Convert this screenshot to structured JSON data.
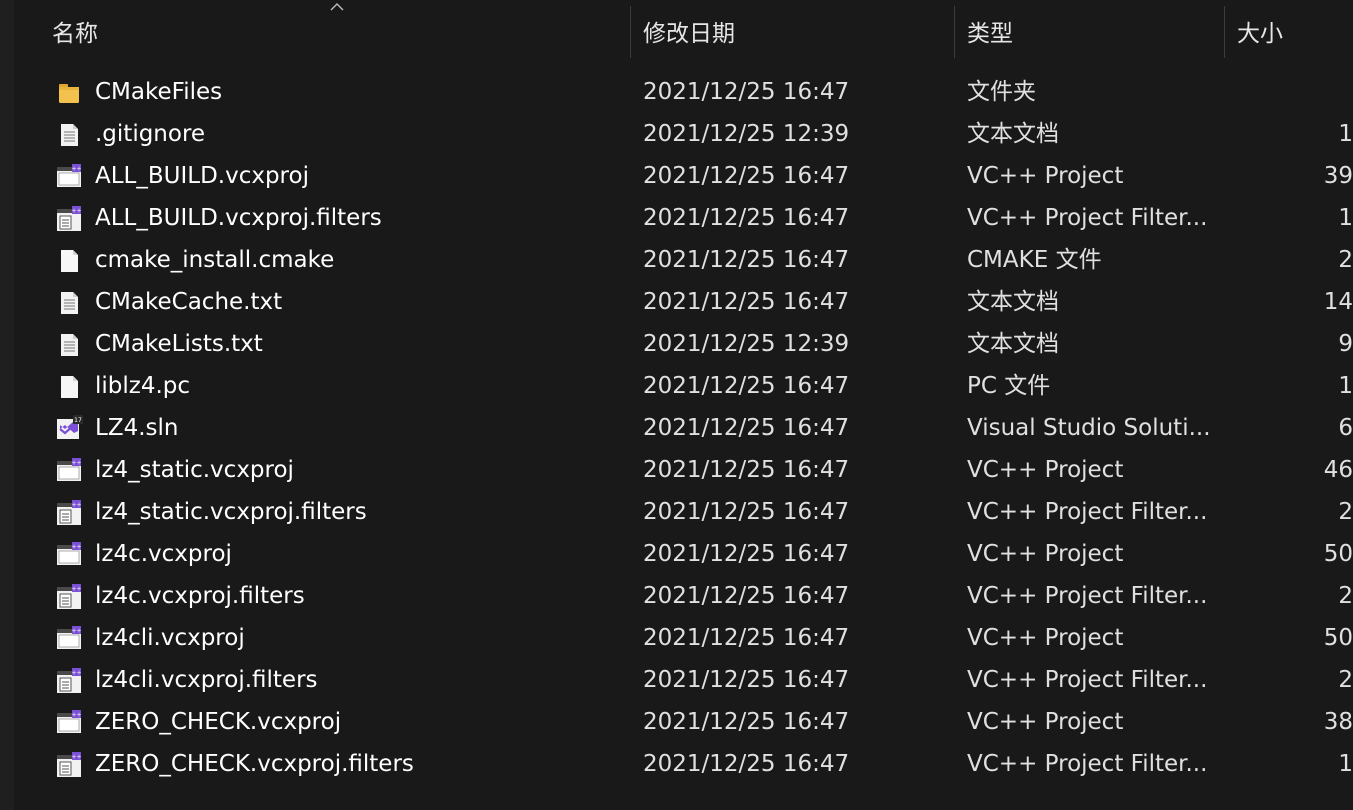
{
  "header": {
    "name": "名称",
    "date": "修改日期",
    "type": "类型",
    "size": "大小"
  },
  "files": [
    {
      "icon": "folder-icon",
      "name": "CMakeFiles",
      "date": "2021/12/25 16:47",
      "type": "文件夹",
      "size": ""
    },
    {
      "icon": "text-file-icon",
      "name": ".gitignore",
      "date": "2021/12/25 12:39",
      "type": "文本文档",
      "size": "1"
    },
    {
      "icon": "vcxproj-icon",
      "name": "ALL_BUILD.vcxproj",
      "date": "2021/12/25 16:47",
      "type": "VC++ Project",
      "size": "39"
    },
    {
      "icon": "filters-icon",
      "name": "ALL_BUILD.vcxproj.filters",
      "date": "2021/12/25 16:47",
      "type": "VC++ Project Filter...",
      "size": "1"
    },
    {
      "icon": "blank-file-icon",
      "name": "cmake_install.cmake",
      "date": "2021/12/25 16:47",
      "type": "CMAKE 文件",
      "size": "2"
    },
    {
      "icon": "text-file-icon",
      "name": "CMakeCache.txt",
      "date": "2021/12/25 16:47",
      "type": "文本文档",
      "size": "14"
    },
    {
      "icon": "text-file-icon",
      "name": "CMakeLists.txt",
      "date": "2021/12/25 12:39",
      "type": "文本文档",
      "size": "9"
    },
    {
      "icon": "blank-file-icon",
      "name": "liblz4.pc",
      "date": "2021/12/25 16:47",
      "type": "PC 文件",
      "size": "1"
    },
    {
      "icon": "visual-studio-solution-icon",
      "name": "LZ4.sln",
      "date": "2021/12/25 16:47",
      "type": "Visual Studio Soluti...",
      "size": "6"
    },
    {
      "icon": "vcxproj-icon",
      "name": "lz4_static.vcxproj",
      "date": "2021/12/25 16:47",
      "type": "VC++ Project",
      "size": "46"
    },
    {
      "icon": "filters-icon",
      "name": "lz4_static.vcxproj.filters",
      "date": "2021/12/25 16:47",
      "type": "VC++ Project Filter...",
      "size": "2"
    },
    {
      "icon": "vcxproj-icon",
      "name": "lz4c.vcxproj",
      "date": "2021/12/25 16:47",
      "type": "VC++ Project",
      "size": "50"
    },
    {
      "icon": "filters-icon",
      "name": "lz4c.vcxproj.filters",
      "date": "2021/12/25 16:47",
      "type": "VC++ Project Filter...",
      "size": "2"
    },
    {
      "icon": "vcxproj-icon",
      "name": "lz4cli.vcxproj",
      "date": "2021/12/25 16:47",
      "type": "VC++ Project",
      "size": "50"
    },
    {
      "icon": "filters-icon",
      "name": "lz4cli.vcxproj.filters",
      "date": "2021/12/25 16:47",
      "type": "VC++ Project Filter...",
      "size": "2"
    },
    {
      "icon": "vcxproj-icon",
      "name": "ZERO_CHECK.vcxproj",
      "date": "2021/12/25 16:47",
      "type": "VC++ Project",
      "size": "38"
    },
    {
      "icon": "filters-icon",
      "name": "ZERO_CHECK.vcxproj.filters",
      "date": "2021/12/25 16:47",
      "type": "VC++ Project Filter...",
      "size": "1"
    }
  ],
  "colors": {
    "background": "#191919",
    "folder": "#f2c14e",
    "vs_purple": "#7b4fd6"
  }
}
